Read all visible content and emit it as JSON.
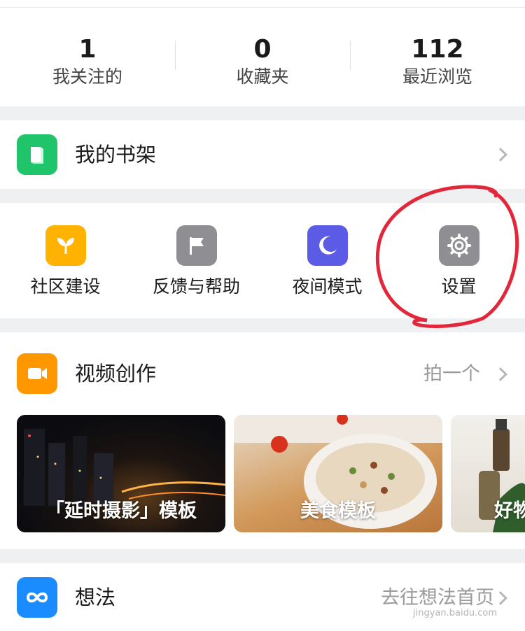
{
  "stats": [
    {
      "value": "1",
      "label": "我关注的"
    },
    {
      "value": "0",
      "label": "收藏夹"
    },
    {
      "value": "112",
      "label": "最近浏览"
    }
  ],
  "bookshelf": {
    "title": "我的书架",
    "icon": "book-icon",
    "color": "#1fc46b"
  },
  "tools": [
    {
      "label": "社区建设",
      "icon": "sprout-icon",
      "color": "#ffb300"
    },
    {
      "label": "反馈与帮助",
      "icon": "flag-icon",
      "color": "#8e8e93"
    },
    {
      "label": "夜间模式",
      "icon": "moon-icon",
      "color": "#5b5be6"
    },
    {
      "label": "设置",
      "icon": "gear-icon",
      "color": "#8e8e93"
    }
  ],
  "video": {
    "title": "视频创作",
    "action": "拍一个",
    "icon": "video-camera-icon",
    "color": "#ff9800",
    "templates": [
      {
        "label": "「延时摄影」模板"
      },
      {
        "label": "美食模板"
      },
      {
        "label": "好物"
      }
    ]
  },
  "ideas": {
    "title": "想法",
    "action": "去往想法首页",
    "icon": "infinity-icon",
    "color": "#1a8cff"
  },
  "watermark": "jingyan.baidu.com",
  "annotation_color": "#e3273b"
}
